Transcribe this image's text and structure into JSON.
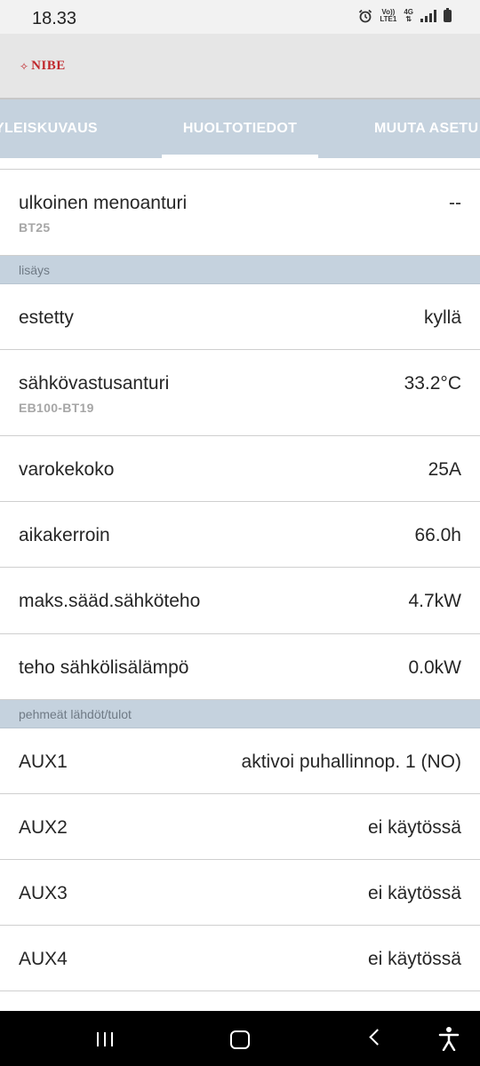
{
  "status_bar": {
    "time": "18.33",
    "volte_top": "Vo))",
    "volte_bottom": "LTE1",
    "network": "4G"
  },
  "app": {
    "logo": "NIBE"
  },
  "tabs": [
    {
      "label": "YLEISKUVAUS"
    },
    {
      "label": "HUOLTOTIEDOT",
      "active": true
    },
    {
      "label": "MUUTA ASETU"
    }
  ],
  "rows": {
    "outdoor_flow": {
      "label": "ulkoinen menoanturi",
      "sub": "BT25",
      "value": "--"
    },
    "section_lisays": "lisäys",
    "blocked": {
      "label": "estetty",
      "value": "kyllä"
    },
    "elec_sensor": {
      "label": "sähkövastusanturi",
      "sub": "EB100-BT19",
      "value": "33.2°C"
    },
    "fuse": {
      "label": "varokekoko",
      "value": "25A"
    },
    "time_factor": {
      "label": "aikakerroin",
      "value": "66.0h"
    },
    "max_power": {
      "label": "maks.sääd.sähköteho",
      "value": "4.7kW"
    },
    "add_heat": {
      "label": "teho sähkölisälämpö",
      "value": "0.0kW"
    },
    "section_soft": "pehmeät lähdöt/tulot",
    "aux1": {
      "label": "AUX1",
      "value": "aktivoi puhallinnop. 1 (NO)"
    },
    "aux2": {
      "label": "AUX2",
      "value": "ei käytössä"
    },
    "aux3": {
      "label": "AUX3",
      "value": "ei käytössä"
    },
    "aux4": {
      "label": "AUX4",
      "value": "ei käytössä"
    }
  }
}
